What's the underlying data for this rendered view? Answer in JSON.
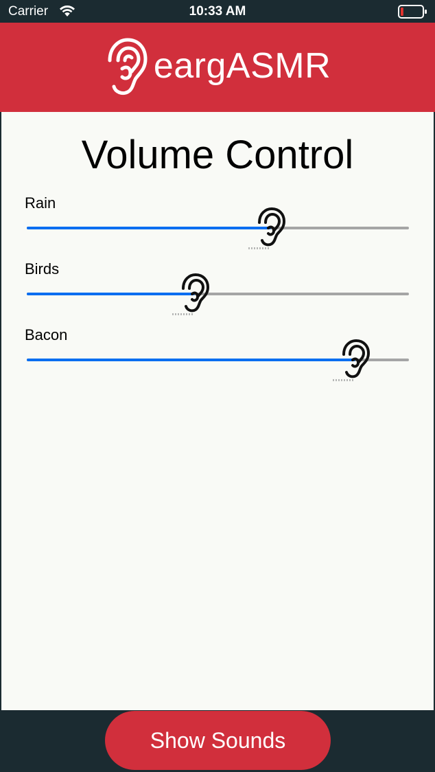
{
  "status_bar": {
    "carrier": "Carrier",
    "time": "10:33 AM",
    "wifi_icon": "wifi-icon",
    "battery_icon": "battery-low-icon",
    "battery_level_percent": 10,
    "battery_color": "#e3342f"
  },
  "header": {
    "logo_icon": "ear-icon",
    "title": "eargASMR",
    "background_color": "#d12f3c"
  },
  "main": {
    "title": "Volume Control",
    "sliders": [
      {
        "label": "Rain",
        "value": 0.64,
        "thumb_icon": "ear-icon"
      },
      {
        "label": "Birds",
        "value": 0.44,
        "thumb_icon": "ear-icon"
      },
      {
        "label": "Bacon",
        "value": 0.86,
        "thumb_icon": "ear-icon"
      }
    ],
    "slider_fill_color": "#0a6ef0",
    "slider_track_color": "#a5a5a5"
  },
  "footer": {
    "button_label": "Show Sounds",
    "button_color": "#d12f3c"
  }
}
